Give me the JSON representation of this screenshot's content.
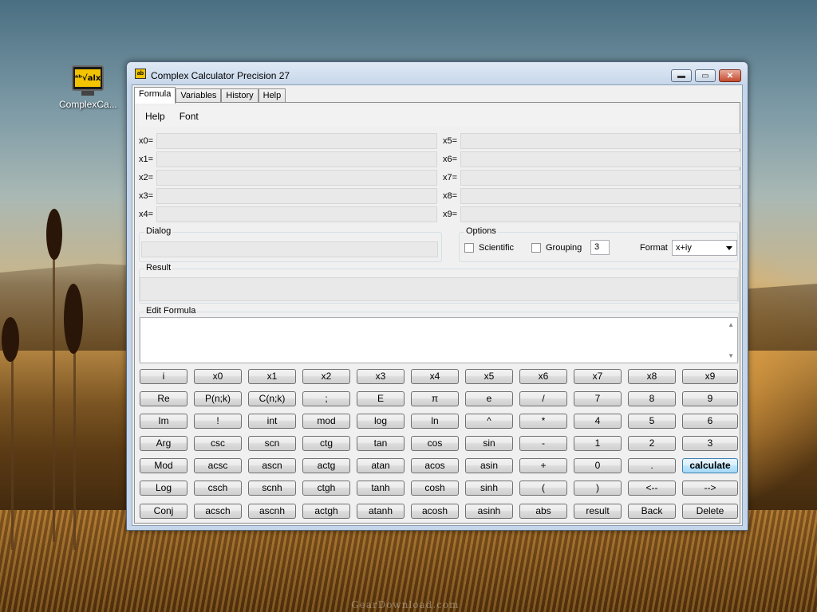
{
  "desktop": {
    "icon_label": "ComplexCa...",
    "icon_screen_text": "ᵃᵇ√alx",
    "watermark": "GearDownload.com"
  },
  "window": {
    "title": "Complex Calculator Precision 27",
    "title_icon_text": "ab",
    "min_glyph": "▬",
    "max_glyph": "▭",
    "close_glyph": "✕"
  },
  "tabs": [
    "Formula",
    "Variables",
    "History",
    "Help"
  ],
  "menu": [
    "Help",
    "Font"
  ],
  "variables_left": [
    "x0=",
    "x1=",
    "x2=",
    "x3=",
    "x4="
  ],
  "variables_right": [
    "x5=",
    "x6=",
    "x7=",
    "x8=",
    "x9="
  ],
  "dialog": {
    "title": "Dialog"
  },
  "options": {
    "title": "Options",
    "scientific_label": "Scientific",
    "grouping_label": "Grouping",
    "precision_value": "3",
    "format_label": "Format",
    "format_value": "x+iy"
  },
  "result": {
    "title": "Result"
  },
  "edit_formula": {
    "title": "Edit Formula",
    "scroll_up": "▲",
    "scroll_down": "▼"
  },
  "keys": [
    [
      "i",
      "x0",
      "x1",
      "x2",
      "x3",
      "x4",
      "x5",
      "x6",
      "x7",
      "x8",
      "x9"
    ],
    [
      "Re",
      "P(n;k)",
      "C(n;k)",
      ";",
      "E",
      "π",
      "e",
      "/",
      "7",
      "8",
      "9"
    ],
    [
      "Im",
      "!",
      "int",
      "mod",
      "log",
      "ln",
      "^",
      "*",
      "4",
      "5",
      "6"
    ],
    [
      "Arg",
      "csc",
      "scn",
      "ctg",
      "tan",
      "cos",
      "sin",
      "-",
      "1",
      "2",
      "3"
    ],
    [
      "Mod",
      "acsc",
      "ascn",
      "actg",
      "atan",
      "acos",
      "asin",
      "+",
      "0",
      ".",
      "calculate"
    ],
    [
      "Log",
      "csch",
      "scnh",
      "ctgh",
      "tanh",
      "cosh",
      "sinh",
      "(",
      ")",
      "<--",
      "-->"
    ],
    [
      "Conj",
      "acsch",
      "ascnh",
      "actgh",
      "atanh",
      "acosh",
      "asinh",
      "abs",
      "result",
      "Back",
      "Delete"
    ]
  ]
}
